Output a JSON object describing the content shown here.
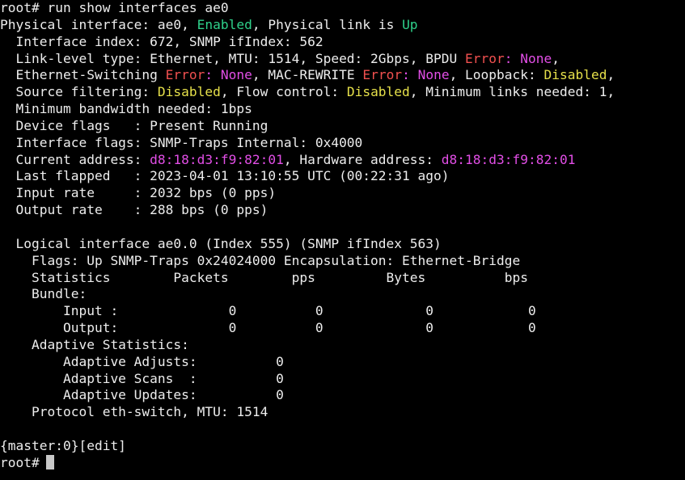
{
  "colors": {
    "background": "#000000",
    "text": "#ededed",
    "green": "#2fd18b",
    "red": "#f0504f",
    "magenta": "#e24ee6",
    "yellow": "#e6e04a"
  },
  "terminal": {
    "prompt_cmd": "root# run show interfaces ae0",
    "phys": {
      "prefix": "Physical interface: ae0, ",
      "enabled": "Enabled",
      "mid": ", Physical link is ",
      "up": "Up"
    },
    "iface_index": "  Interface index: 672, SNMP ifIndex: 562",
    "link_level": {
      "prefix": "  Link-level type: Ethernet, MTU: 1514, Speed: 2Gbps, BPDU ",
      "error": "Error",
      "colon": ": ",
      "none": "None",
      "suffix": ","
    },
    "eth_switching": {
      "prefix": "  Ethernet-Switching ",
      "error1": "Error",
      "colon1": ": ",
      "none1": "None",
      "mid": ", MAC-REWRITE ",
      "error2": "Error",
      "colon2": ": ",
      "none2": "None",
      "loop_label": ", Loopback: ",
      "loop_val": "Disabled",
      "suffix": ","
    },
    "source_filter": {
      "prefix": "  Source filtering: ",
      "val1": "Disabled",
      "mid": ", Flow control: ",
      "val2": "Disabled",
      "suffix": ", Minimum links needed: 1,"
    },
    "min_bw": "  Minimum bandwidth needed: 1bps",
    "device_flags": "  Device flags   : Present Running",
    "iface_flags": "  Interface flags: SNMP-Traps Internal: 0x4000",
    "address": {
      "prefix": "  Current address: ",
      "current": "d8:18:d3:f9:82:01",
      "mid": ", Hardware address: ",
      "hardware": "d8:18:d3:f9:82:01"
    },
    "last_flapped": "  Last flapped   : 2023-04-01 13:10:55 UTC (00:22:31 ago)",
    "input_rate": "  Input rate     : 2032 bps (0 pps)",
    "output_rate": "  Output rate    : 288 bps (0 pps)",
    "logical_iface": "  Logical interface ae0.0 (Index 555) (SNMP ifIndex 563)",
    "logical_flags": "    Flags: Up SNMP-Traps 0x24024000 Encapsulation: Ethernet-Bridge",
    "stats_header": "    Statistics        Packets        pps         Bytes          bps",
    "bundle": "    Bundle:",
    "bundle_input": "        Input :              0          0             0            0",
    "bundle_output": "        Output:              0          0             0            0",
    "adaptive_stats": "    Adaptive Statistics:",
    "adaptive_adjusts": "        Adaptive Adjusts:          0",
    "adaptive_scans": "        Adaptive Scans  :          0",
    "adaptive_updates": "        Adaptive Updates:          0",
    "protocol": "    Protocol eth-switch, MTU: 1514",
    "master_edit": "{master:0}[edit]",
    "final_prompt": "root#"
  }
}
